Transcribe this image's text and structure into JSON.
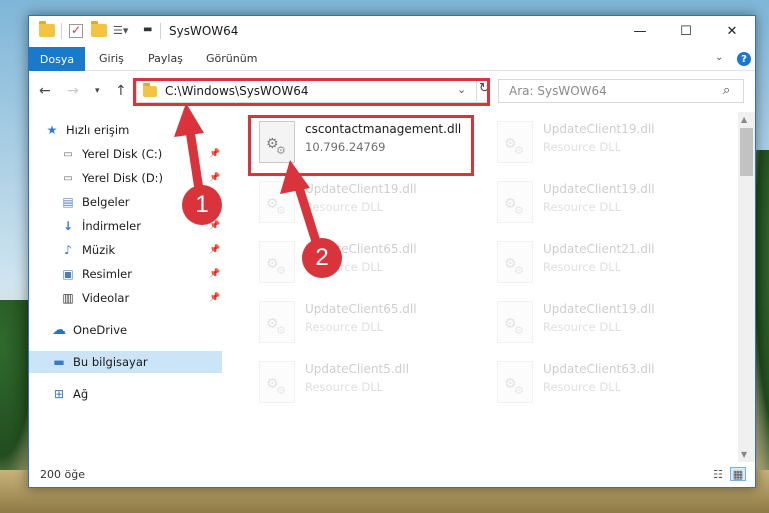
{
  "window": {
    "title": "SysWOW64"
  },
  "ribbon": {
    "tabs": [
      "Dosya",
      "Giriş",
      "Paylaş",
      "Görünüm"
    ],
    "help": "?"
  },
  "address": {
    "path": "C:\\Windows\\SysWOW64",
    "search_placeholder": "Ara: SysWOW64"
  },
  "sidebar": {
    "items": [
      {
        "label": "Hızlı erişim",
        "icon": "star-icon"
      },
      {
        "label": "Yerel Disk (C:)",
        "icon": "drive-icon",
        "pinned": true
      },
      {
        "label": "Yerel Disk (D:)",
        "icon": "drive-icon",
        "pinned": true
      },
      {
        "label": "Belgeler",
        "icon": "documents-icon",
        "pinned": true
      },
      {
        "label": "İndirmeler",
        "icon": "download-icon",
        "pinned": true
      },
      {
        "label": "Müzik",
        "icon": "music-icon",
        "pinned": true
      },
      {
        "label": "Resimler",
        "icon": "pictures-icon",
        "pinned": true
      },
      {
        "label": "Videolar",
        "icon": "videos-icon",
        "pinned": true
      },
      {
        "label": "OneDrive",
        "icon": "cloud-icon"
      },
      {
        "label": "Bu bilgisayar",
        "icon": "computer-icon",
        "selected": true
      },
      {
        "label": "Ağ",
        "icon": "network-icon"
      }
    ]
  },
  "files": [
    {
      "name": "cscontactmanagement.dll",
      "sub": "10.796.24769",
      "highlighted": true
    },
    {
      "name": "UpdateClient19.dll",
      "sub": "Resource DLL"
    },
    {
      "name": "UpdateClient19.dll",
      "sub": "Resource DLL"
    },
    {
      "name": "UpdateClient19.dll",
      "sub": "Resource DLL"
    },
    {
      "name": "UpdateClient65.dll",
      "sub": "Resource DLL"
    },
    {
      "name": "UpdateClient21.dll",
      "sub": "Resource DLL"
    },
    {
      "name": "UpdateClient65.dll",
      "sub": "Resource DLL"
    },
    {
      "name": "UpdateClient19.dll",
      "sub": "Resource DLL"
    },
    {
      "name": "UpdateClient5.dll",
      "sub": "Resource DLL"
    },
    {
      "name": "UpdateClient63.dll",
      "sub": "Resource DLL"
    }
  ],
  "status": {
    "count": "200 öğe"
  },
  "annotations": {
    "callout_1": "1",
    "callout_2": "2",
    "color": "#d9343b"
  },
  "colors": {
    "accent": "#1979ca",
    "selection": "#cce4f7"
  }
}
